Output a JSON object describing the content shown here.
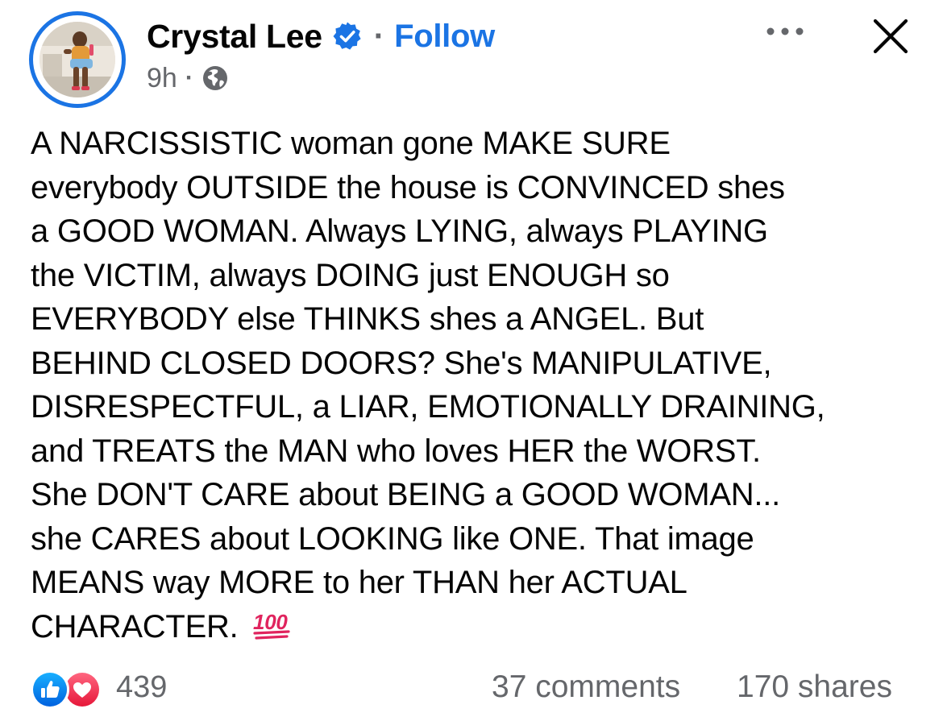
{
  "post": {
    "author": {
      "name": "Crystal Lee",
      "verified": true,
      "avatar_icon": "profile-photo"
    },
    "follow_label": "Follow",
    "separator": "·",
    "timestamp": "9h",
    "audience_icon": "globe-icon",
    "text_lines": [
      "A NARCISSISTIC woman gone MAKE SURE",
      "everybody OUTSIDE the house is CONVINCED shes",
      "a GOOD WOMAN. Always LYING, always PLAYING",
      "the VICTIM, always DOING just ENOUGH so",
      "EVERYBODY else THINKS shes a ANGEL. But",
      "BEHIND CLOSED DOORS? She's MANIPULATIVE,",
      "DISRESPECTFUL, a LIAR, EMOTIONALLY DRAINING,",
      "and TREATS the MAN who loves HER the WORST.",
      "She DON'T CARE about BEING a GOOD WOMAN...",
      "she CARES about LOOKING like ONE. That image",
      "MEANS way MORE to her THAN her ACTUAL",
      "CHARACTER."
    ],
    "trailing_emoji": "hundred-points-emoji",
    "reactions": {
      "types": [
        "like",
        "love"
      ],
      "count": "439"
    },
    "comments": "37 comments",
    "shares": "170 shares"
  },
  "colors": {
    "accent": "#1b74e4",
    "secondary_text": "#65676b",
    "love": "#f33e58",
    "hundred": "#e0245e"
  },
  "icons": {
    "more": "more-options-icon",
    "close": "close-icon",
    "verified": "verified-badge-icon",
    "globe": "globe-icon"
  }
}
